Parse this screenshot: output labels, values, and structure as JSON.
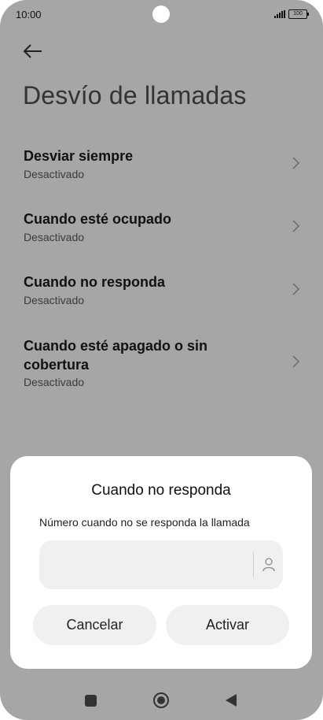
{
  "status_bar": {
    "time": "10:00",
    "battery": "100"
  },
  "page": {
    "title": "Desvío de llamadas"
  },
  "list": {
    "items": [
      {
        "title": "Desviar siempre",
        "status": "Desactivado"
      },
      {
        "title": "Cuando esté ocupado",
        "status": "Desactivado"
      },
      {
        "title": "Cuando no responda",
        "status": "Desactivado"
      },
      {
        "title": "Cuando esté apagado o sin cobertura",
        "status": "Desactivado"
      }
    ]
  },
  "dialog": {
    "title": "Cuando no responda",
    "description": "Número cuando no se responda la llamada",
    "input_value": "",
    "cancel_label": "Cancelar",
    "confirm_label": "Activar"
  },
  "icons": {
    "back": "arrow-left-icon",
    "chevron": "chevron-right-icon",
    "contact": "person-icon",
    "nav_recents": "square-icon",
    "nav_home": "circle-icon",
    "nav_back": "triangle-back-icon"
  }
}
